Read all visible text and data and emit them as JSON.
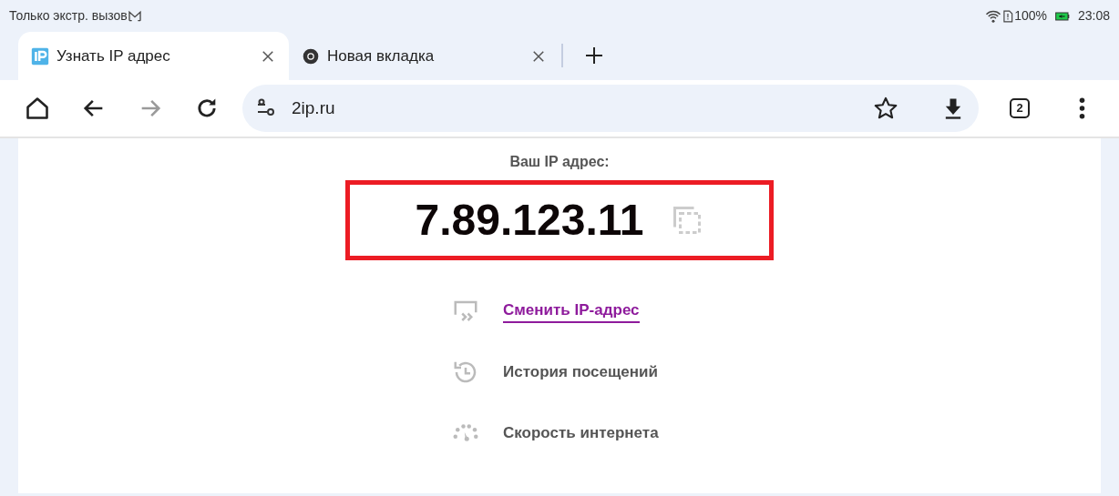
{
  "status_bar": {
    "carrier": "Только экстр. вызов",
    "battery": "100%",
    "battery_charging": true,
    "time": "23:08"
  },
  "tabs": [
    {
      "title": "Узнать IP адрес",
      "selected": true
    },
    {
      "title": "Новая вкладка",
      "selected": false
    }
  ],
  "toolbar": {
    "forward_disabled": true,
    "url": "2ip.ru",
    "tab_count": "2"
  },
  "page": {
    "label": "Ваш IP адрес:",
    "ip": "7.89.123.11",
    "ip_highlighted": true,
    "items": [
      {
        "kind": "link",
        "text": "Сменить IP-адрес"
      },
      {
        "kind": "text",
        "text": "История посещений"
      },
      {
        "kind": "text",
        "text": "Скорость интернета"
      }
    ]
  }
}
